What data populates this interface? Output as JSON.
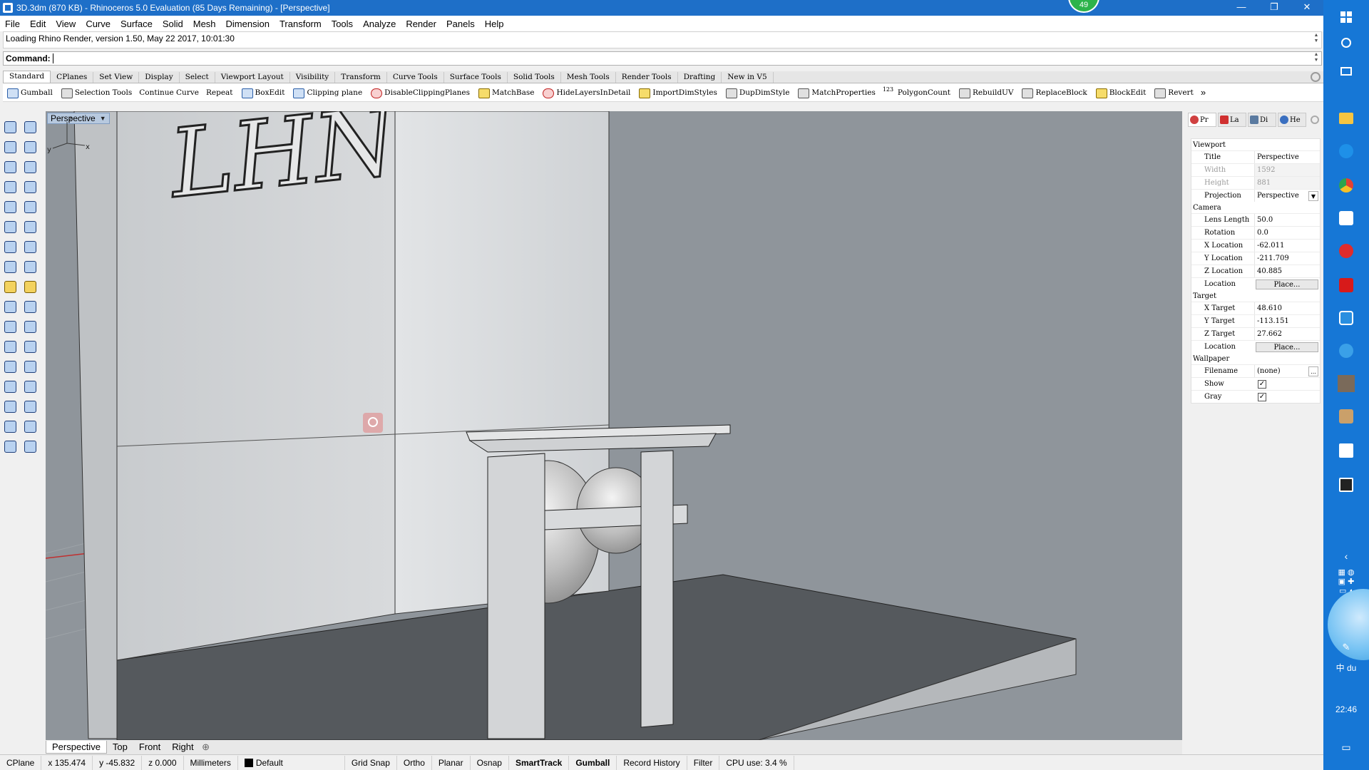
{
  "window": {
    "title": "3D.3dm (870 KB) - Rhinoceros 5.0 Evaluation (85 Days Remaining) - [Perspective]",
    "badge": "49",
    "controls": [
      "—",
      "❐",
      "✕"
    ]
  },
  "menubar": [
    "File",
    "Edit",
    "View",
    "Curve",
    "Surface",
    "Solid",
    "Mesh",
    "Dimension",
    "Transform",
    "Tools",
    "Analyze",
    "Render",
    "Panels",
    "Help"
  ],
  "command": {
    "history": "Loading Rhino Render, version 1.50, May 22 2017, 10:01:30",
    "prompt_label": "Command:",
    "value": ""
  },
  "toolbar_tabs": [
    "Standard",
    "CPlanes",
    "Set View",
    "Display",
    "Select",
    "Viewport Layout",
    "Visibility",
    "Transform",
    "Curve Tools",
    "Surface Tools",
    "Solid Tools",
    "Mesh Tools",
    "Render Tools",
    "Drafting",
    "New in V5"
  ],
  "toolbar_active_tab": "Standard",
  "commands": [
    {
      "label": "Gumball",
      "icon": "gumball-icon"
    },
    {
      "label": "Selection Tools",
      "icon": "selection-tools-icon"
    },
    {
      "label": "Continue Curve",
      "icon": ""
    },
    {
      "label": "Repeat",
      "icon": ""
    },
    {
      "label": "BoxEdit",
      "icon": "boxedit-icon"
    },
    {
      "label": "Clipping plane",
      "icon": "clipping-plane-icon"
    },
    {
      "label": "DisableClippingPlanes",
      "icon": "disable-clipping-icon"
    },
    {
      "label": "MatchBase",
      "icon": "matchbase-icon"
    },
    {
      "label": "HideLayersInDetail",
      "icon": "hide-layers-icon"
    },
    {
      "label": "ImportDimStyles",
      "icon": "import-dimstyles-icon"
    },
    {
      "label": "DupDimStyle",
      "icon": "dupdimstyle-icon"
    },
    {
      "label": "MatchProperties",
      "icon": "matchproperties-icon"
    },
    {
      "label": "PolygonCount",
      "icon": "polygoncount-icon",
      "prefix": "123"
    },
    {
      "label": "RebuildUV",
      "icon": "rebuilduv-icon"
    },
    {
      "label": "ReplaceBlock",
      "icon": "replaceblock-icon"
    },
    {
      "label": "BlockEdit",
      "icon": "blockedit-icon"
    },
    {
      "label": "Revert",
      "icon": "revert-icon"
    }
  ],
  "viewport": {
    "title": "Perspective",
    "model_text": "LHN",
    "axis_labels": [
      "z",
      "y",
      "x"
    ]
  },
  "viewport_tabs": [
    "Perspective",
    "Top",
    "Front",
    "Right"
  ],
  "panel": {
    "tabs": [
      "Pr",
      "La",
      "Di",
      "He"
    ],
    "sections": [
      {
        "title": "Viewport",
        "rows": [
          {
            "key": "Title",
            "value": "Perspective"
          },
          {
            "key": "Width",
            "value": "1592",
            "disabled": true
          },
          {
            "key": "Height",
            "value": "881",
            "disabled": true
          },
          {
            "key": "Projection",
            "value": "Perspective",
            "dropdown": true
          }
        ]
      },
      {
        "title": "Camera",
        "rows": [
          {
            "key": "Lens Length",
            "value": "50.0"
          },
          {
            "key": "Rotation",
            "value": "0.0"
          },
          {
            "key": "X Location",
            "value": "-62.011"
          },
          {
            "key": "Y Location",
            "value": "-211.709"
          },
          {
            "key": "Z Location",
            "value": "40.885"
          },
          {
            "key": "Location",
            "button": "Place..."
          }
        ]
      },
      {
        "title": "Target",
        "rows": [
          {
            "key": "X Target",
            "value": "48.610"
          },
          {
            "key": "Y Target",
            "value": "-113.151"
          },
          {
            "key": "Z Target",
            "value": "27.662"
          },
          {
            "key": "Location",
            "button": "Place..."
          }
        ]
      },
      {
        "title": "Wallpaper",
        "rows": [
          {
            "key": "Filename",
            "value": "(none)",
            "browse": "..."
          },
          {
            "key": "Show",
            "checkbox": true
          },
          {
            "key": "Gray",
            "checkbox": true
          }
        ]
      }
    ]
  },
  "statusbar": {
    "cplane": "CPlane",
    "x": "x 135.474",
    "y": "y -45.832",
    "z": "z 0.000",
    "units": "Millimeters",
    "layer": "Default",
    "toggles": [
      {
        "label": "Grid Snap",
        "bold": false
      },
      {
        "label": "Ortho",
        "bold": false
      },
      {
        "label": "Planar",
        "bold": false
      },
      {
        "label": "Osnap",
        "bold": false
      },
      {
        "label": "SmartTrack",
        "bold": true
      },
      {
        "label": "Gumball",
        "bold": true
      },
      {
        "label": "Record History",
        "bold": false
      },
      {
        "label": "Filter",
        "bold": false
      }
    ],
    "cpu": "CPU use: 3.4 %"
  },
  "taskbar": {
    "time": "22:46",
    "ime": "中",
    "ime2": "du"
  },
  "colors": {
    "titlebar": "#1e6fc8",
    "taskbar": "#1677d6",
    "viewport_bg": "#8f959b"
  }
}
